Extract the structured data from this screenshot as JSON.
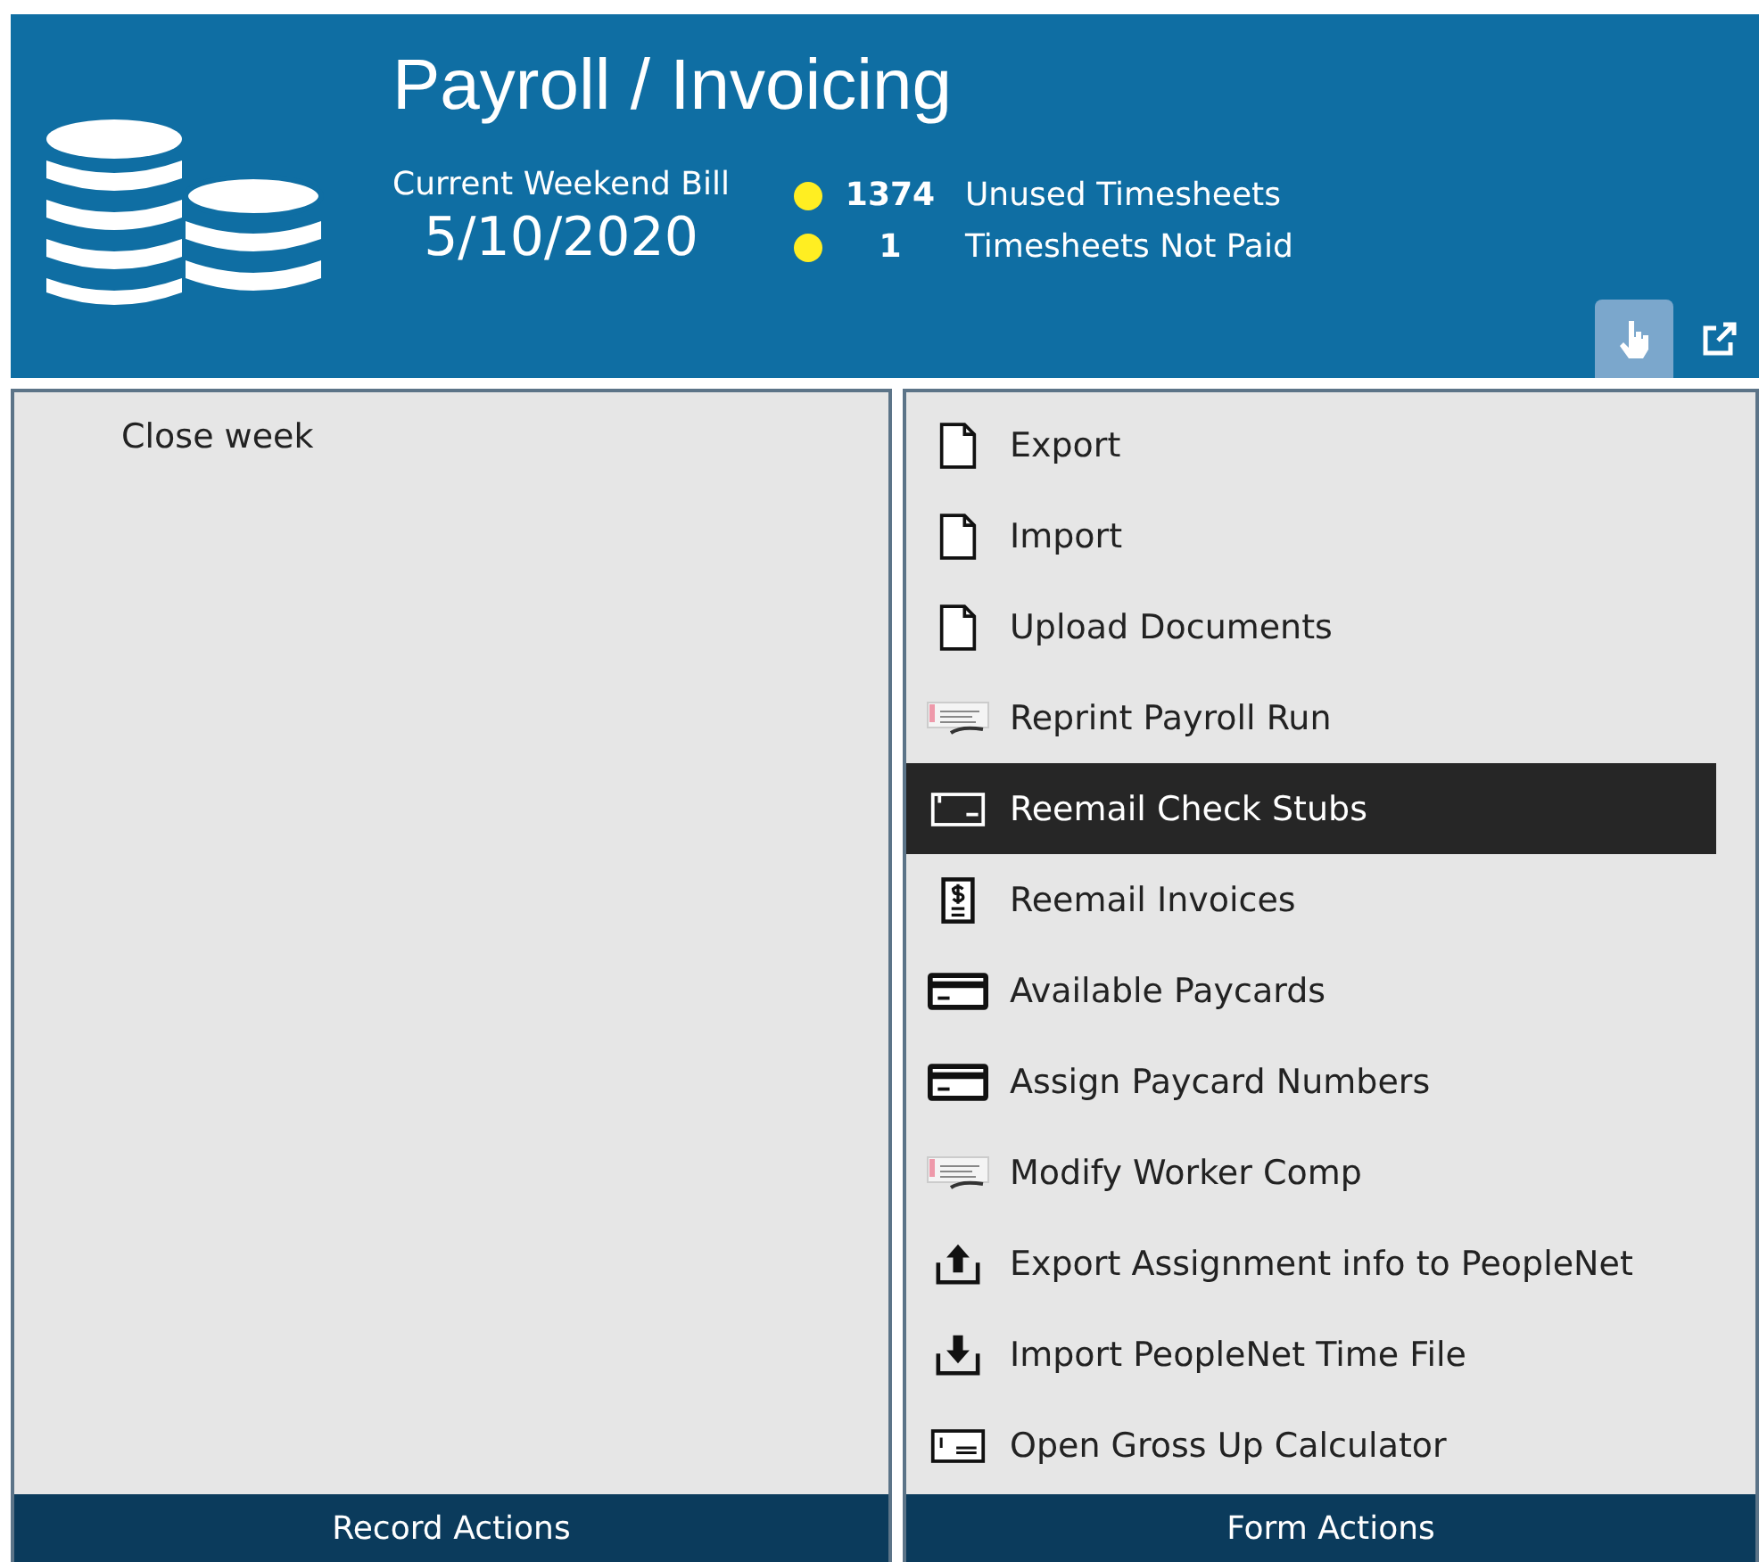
{
  "header": {
    "title": "Payroll / Invoicing",
    "bill_label": "Current Weekend Bill",
    "bill_date": "5/10/2020",
    "metrics": [
      {
        "count": "1374",
        "label": "Unused Timesheets"
      },
      {
        "count": "1",
        "label": "Timesheets Not Paid"
      }
    ],
    "tools": [
      {
        "kind": "hand",
        "selected": true
      },
      {
        "kind": "popout",
        "selected": false
      }
    ]
  },
  "record_actions": {
    "items": [
      "Close week"
    ],
    "footer": "Record Actions"
  },
  "form_actions": {
    "items": [
      {
        "kind": "document",
        "label": "Export",
        "selected": false
      },
      {
        "kind": "document",
        "label": "Import",
        "selected": false
      },
      {
        "kind": "document",
        "label": "Upload Documents",
        "selected": false
      },
      {
        "kind": "check-image",
        "label": "Reprint Payroll Run",
        "selected": false
      },
      {
        "kind": "stub",
        "label": "Reemail Check Stubs",
        "selected": true
      },
      {
        "kind": "invoice",
        "label": "Reemail Invoices",
        "selected": false
      },
      {
        "kind": "card",
        "label": "Available Paycards",
        "selected": false
      },
      {
        "kind": "card",
        "label": "Assign Paycard Numbers",
        "selected": false
      },
      {
        "kind": "check-image",
        "label": "Modify Worker Comp",
        "selected": false
      },
      {
        "kind": "upload",
        "label": "Export Assignment info to PeopleNet",
        "selected": false
      },
      {
        "kind": "download",
        "label": "Import PeopleNet Time File",
        "selected": false
      },
      {
        "kind": "calculator",
        "label": "Open Gross Up Calculator",
        "selected": false
      }
    ],
    "footer": "Form Actions"
  }
}
